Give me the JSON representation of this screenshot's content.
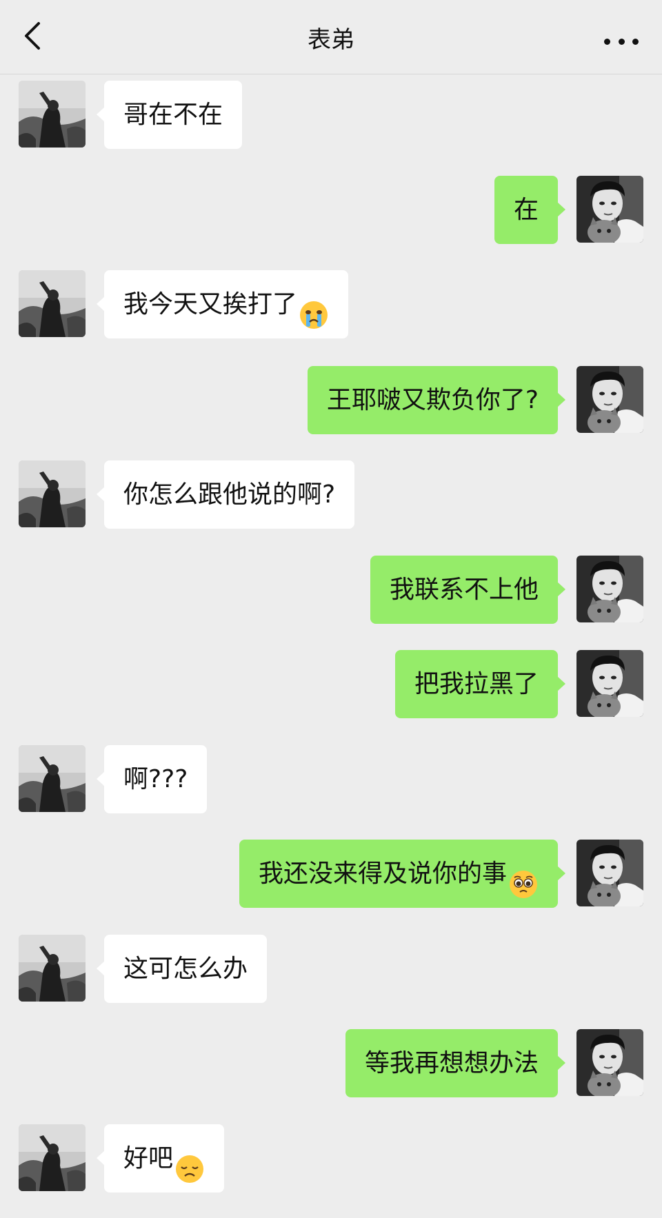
{
  "header": {
    "title": "表弟",
    "back_icon": "chevron-left-icon",
    "more_icon": "more-dots-icon"
  },
  "colors": {
    "background": "#ededed",
    "incoming_bubble": "#ffffff",
    "outgoing_bubble": "#95ec69"
  },
  "messages": [
    {
      "side": "left",
      "text": "哥在不在",
      "emoji": ""
    },
    {
      "side": "right",
      "text": "在",
      "emoji": ""
    },
    {
      "side": "left",
      "text": "我今天又挨打了",
      "emoji": "crying-face"
    },
    {
      "side": "right",
      "text": "王耶啵又欺负你了?",
      "emoji": ""
    },
    {
      "side": "left",
      "text": "你怎么跟他说的啊?",
      "emoji": ""
    },
    {
      "side": "right",
      "text": "我联系不上他",
      "emoji": ""
    },
    {
      "side": "right",
      "text": "把我拉黑了",
      "emoji": ""
    },
    {
      "side": "left",
      "text": "啊???",
      "emoji": ""
    },
    {
      "side": "right",
      "text": "我还没来得及说你的事",
      "emoji": "pleading-face"
    },
    {
      "side": "left",
      "text": "这可怎么办",
      "emoji": ""
    },
    {
      "side": "right",
      "text": "等我再想想办法",
      "emoji": ""
    },
    {
      "side": "left",
      "text": "好吧",
      "emoji": "disappointed-face"
    }
  ]
}
